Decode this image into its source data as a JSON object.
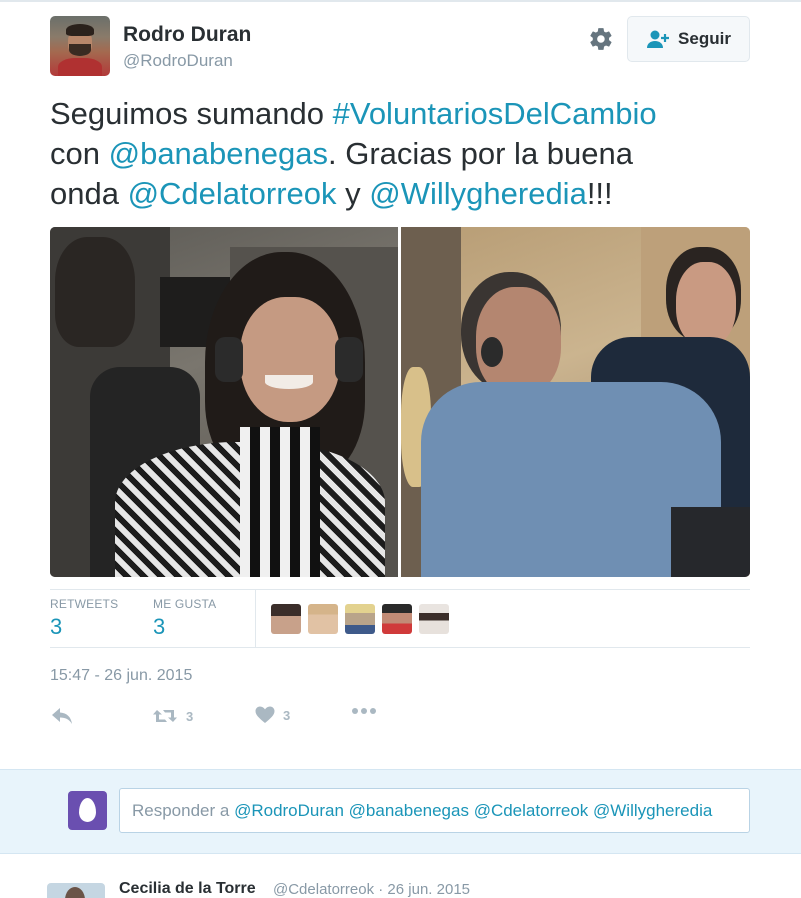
{
  "author": {
    "name": "Rodro Duran",
    "handle": "@RodroDuran"
  },
  "header": {
    "follow_label": "Seguir"
  },
  "tweet": {
    "parts": [
      {
        "text": "Seguimos sumando ",
        "link": false
      },
      {
        "text": "#VoluntariosDelCambio",
        "link": true
      },
      {
        "text": "\ncon ",
        "link": false
      },
      {
        "text": "@banabenegas",
        "link": true
      },
      {
        "text": ". Gracias por la buena\nonda ",
        "link": false
      },
      {
        "text": "@Cdelatorreok",
        "link": true
      },
      {
        "text": " y ",
        "link": false
      },
      {
        "text": "@Willygheredia",
        "link": true
      },
      {
        "text": "!!!",
        "link": false
      }
    ]
  },
  "stats": {
    "retweets_label": "RETWEETS",
    "retweets_value": "3",
    "likes_label": "ME GUSTA",
    "likes_value": "3"
  },
  "timestamp": "15:47 - 26 jun. 2015",
  "actions": {
    "retweet_count": "3",
    "like_count": "3"
  },
  "reply": {
    "prefix": "Responder a ",
    "mentions": "@RodroDuran @banabenegas @Cdelatorreok @Willygheredia"
  },
  "next_tweet": {
    "name": "Cecilia de la Torre",
    "meta": "@Cdelatorreok · 26 jun. 2015"
  },
  "colors": {
    "link": "#1b95b8",
    "muted": "#8899a6",
    "reply_bg": "#e8f4fb",
    "egg_avatar": "#6a4fb0"
  }
}
